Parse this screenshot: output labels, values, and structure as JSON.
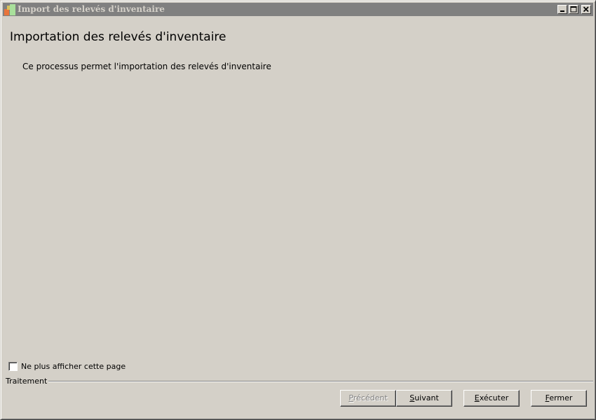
{
  "window": {
    "title": "Import des relevés d'inventaire",
    "controls": {
      "minimize_icon": "minimize-icon",
      "maximize_icon": "maximize-icon",
      "close_icon": "close-icon"
    }
  },
  "main": {
    "title": "Importation des relevés d'inventaire",
    "description": "Ce processus permet l'importation des relevés d'inventaire"
  },
  "options": {
    "dont_show_label": "Ne plus afficher cette page",
    "dont_show_checked": false
  },
  "group": {
    "label": "Traitement"
  },
  "buttons": {
    "previous": {
      "mnemonic": "P",
      "rest": "récédent",
      "enabled": false
    },
    "next": {
      "mnemonic": "S",
      "rest": "uivant",
      "enabled": true
    },
    "execute": {
      "mnemonic": "E",
      "rest": "xécuter",
      "enabled": true
    },
    "close": {
      "mnemonic": "F",
      "rest": "ermer",
      "enabled": true
    }
  },
  "colors": {
    "face": "#d4d0c8",
    "titlebar_inactive": "#808080",
    "disabled_text": "#808080"
  }
}
